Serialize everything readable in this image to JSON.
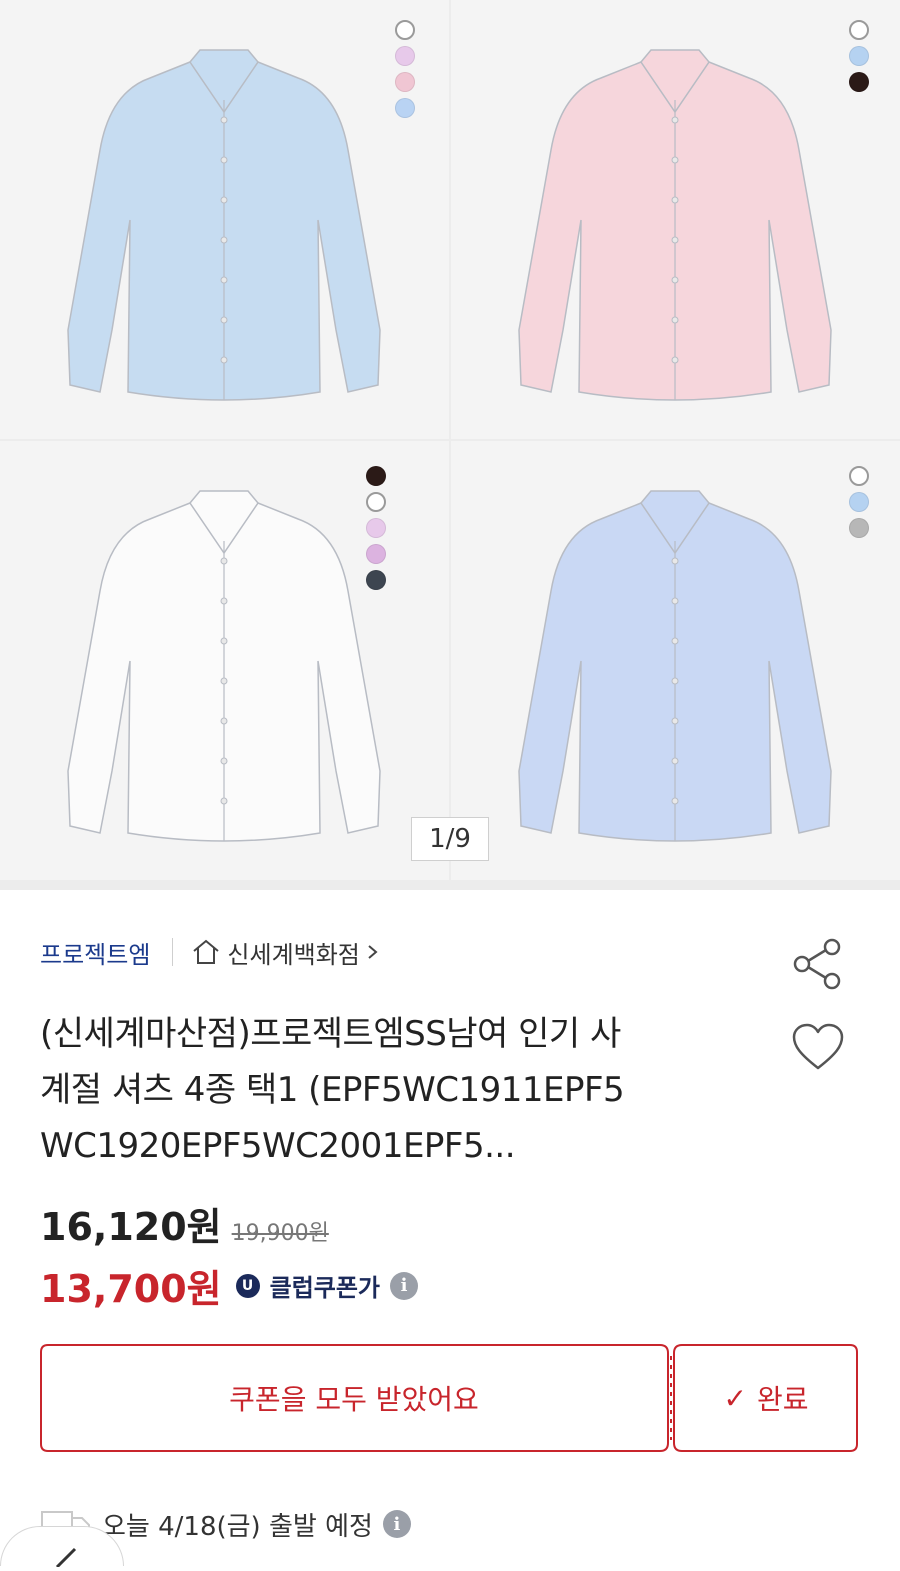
{
  "gallery": {
    "counter": "1/9",
    "products": [
      {
        "color": "#c6dcf1",
        "swatches": [
          "#ffffff",
          "#e7c9ea",
          "#f0c6d3",
          "#b9d3f3"
        ]
      },
      {
        "color": "#f6d6dc",
        "swatches": [
          "#ffffff",
          "#b5d2f1",
          "#2b1a17"
        ]
      },
      {
        "color": "#fbfbfb",
        "swatches": [
          "#2b1a17",
          "#ffffff",
          "#e7c9ea",
          "#dcb3e0",
          "#3d4550"
        ]
      },
      {
        "color": "#c9d8f4",
        "swatches": [
          "#ffffff",
          "#b5d2f1",
          "#b7b7b7"
        ]
      }
    ]
  },
  "brand": "프로젝트엠",
  "store": "신세계백화점",
  "title_lines": [
    "(신세계마산점)프로젝트엠SS남여 인기 사",
    "계절 셔츠 4종 택1 (EPF5WC1911EPF5",
    "WC1920EPF5WC2001EPF5..."
  ],
  "price": {
    "current": "16,120원",
    "original": "19,900원",
    "coupon_price": "13,700원",
    "badge": "U",
    "coupon_label": "클럽쿠폰가",
    "info_glyph": "i"
  },
  "coupon": {
    "message": "쿠폰을 모두 받았어요",
    "done_label": "완료",
    "check_glyph": "✓"
  },
  "shipping": {
    "text": "오늘 4/18(금) 출발 예정",
    "info_glyph": "i"
  },
  "colors": {
    "accent": "#c8252c",
    "brand": "#1b3a8c",
    "club": "#1b2a5a"
  }
}
